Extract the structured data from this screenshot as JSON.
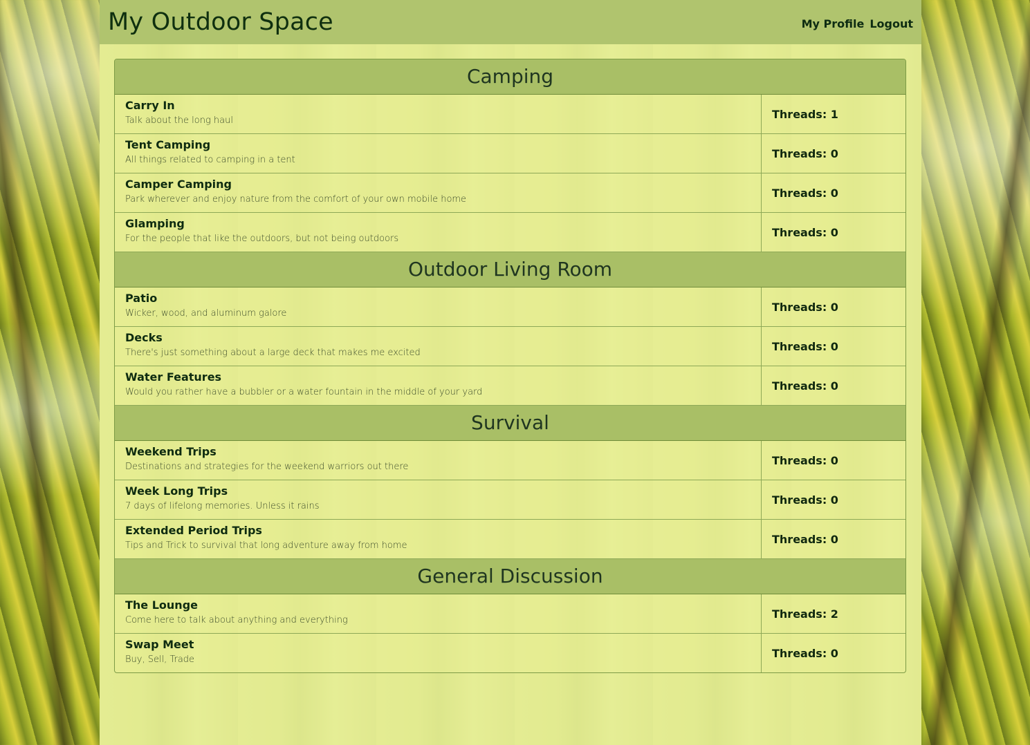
{
  "header": {
    "title": "My Outdoor Space",
    "nav": [
      "My Profile",
      "Logout"
    ]
  },
  "sections": [
    {
      "title": "Camping",
      "forums": [
        {
          "name": "Carry In",
          "desc": "Talk about the long haul",
          "threads": "Threads: 1"
        },
        {
          "name": "Tent Camping",
          "desc": "All things related to camping in a tent",
          "threads": "Threads: 0"
        },
        {
          "name": "Camper Camping",
          "desc": "Park wherever and enjoy nature from the comfort of your own mobile home",
          "threads": "Threads: 0"
        },
        {
          "name": "Glamping",
          "desc": "For the people that like the outdoors, but not being outdoors",
          "threads": "Threads: 0"
        }
      ]
    },
    {
      "title": "Outdoor Living Room",
      "forums": [
        {
          "name": "Patio",
          "desc": "Wicker, wood, and aluminum galore",
          "threads": "Threads: 0"
        },
        {
          "name": "Decks",
          "desc": "There's just something about a large deck that makes me excited",
          "threads": "Threads: 0"
        },
        {
          "name": "Water Features",
          "desc": "Would you rather have a bubbler or a water fountain in the middle of your yard",
          "threads": "Threads: 0"
        }
      ]
    },
    {
      "title": "Survival",
      "forums": [
        {
          "name": "Weekend Trips",
          "desc": "Destinations and strategies for the weekend warriors out there",
          "threads": "Threads: 0"
        },
        {
          "name": "Week Long Trips",
          "desc": "7 days of lifelong memories. Unless it rains",
          "threads": "Threads: 0"
        },
        {
          "name": "Extended Period Trips",
          "desc": "Tips and Trick to survival that long adventure away from home",
          "threads": "Threads: 0"
        }
      ]
    },
    {
      "title": "General Discussion",
      "forums": [
        {
          "name": "The Lounge",
          "desc": "Come here to talk about anything and everything",
          "threads": "Threads: 2"
        },
        {
          "name": "Swap Meet",
          "desc": "Buy, Sell, Trade",
          "threads": "Threads: 0"
        }
      ]
    }
  ]
}
